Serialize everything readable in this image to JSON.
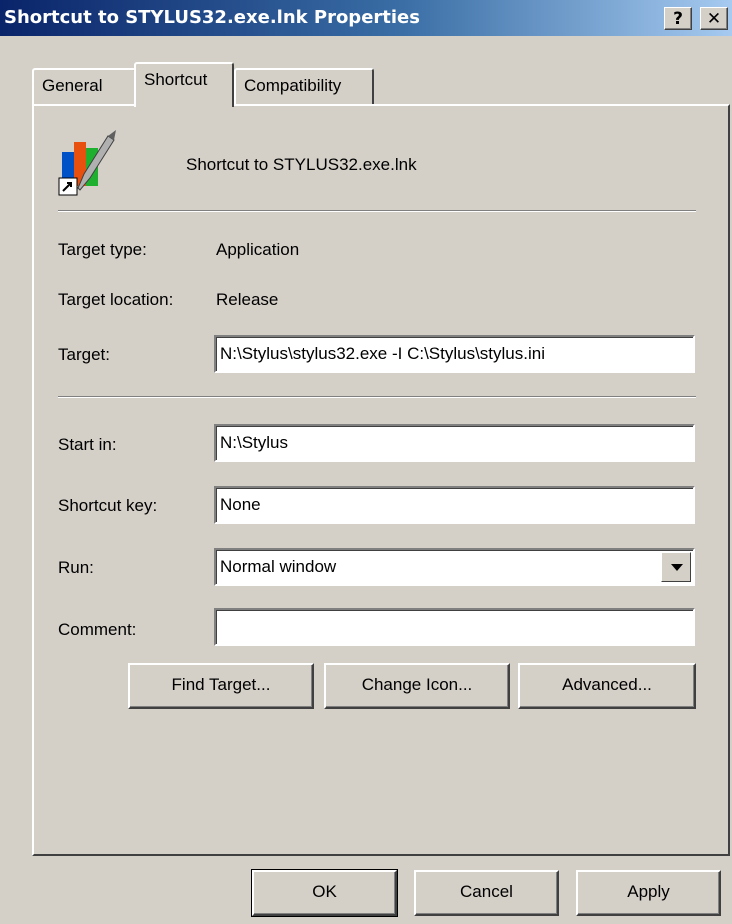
{
  "window": {
    "title": "Shortcut to STYLUS32.exe.lnk Properties",
    "help_button": "?",
    "close_button": "✕"
  },
  "tabs": [
    {
      "label": "General",
      "active": false
    },
    {
      "label": "Shortcut",
      "active": true
    },
    {
      "label": "Compatibility",
      "active": false
    }
  ],
  "header": {
    "icon": "stylus-shortcut-icon",
    "name": "Shortcut to STYLUS32.exe.lnk"
  },
  "properties": {
    "target_type_label": "Target type:",
    "target_type_value": "Application",
    "target_location_label": "Target location:",
    "target_location_value": "Release",
    "target_label": "Target:",
    "target_value": "N:\\Stylus\\stylus32.exe -I C:\\Stylus\\stylus.ini",
    "start_in_label": "Start in:",
    "start_in_value": "N:\\Stylus",
    "shortcut_key_label": "Shortcut key:",
    "shortcut_key_value": "None",
    "run_label": "Run:",
    "run_value": "Normal window",
    "comment_label": "Comment:",
    "comment_value": ""
  },
  "actions": {
    "find_target": "Find Target...",
    "change_icon": "Change Icon...",
    "advanced": "Advanced..."
  },
  "footer": {
    "ok": "OK",
    "cancel": "Cancel",
    "apply": "Apply"
  },
  "colors": {
    "title_gradient_start": "#0a246a",
    "title_gradient_end": "#a6caf0",
    "dialog_face": "#d4d0c8"
  }
}
